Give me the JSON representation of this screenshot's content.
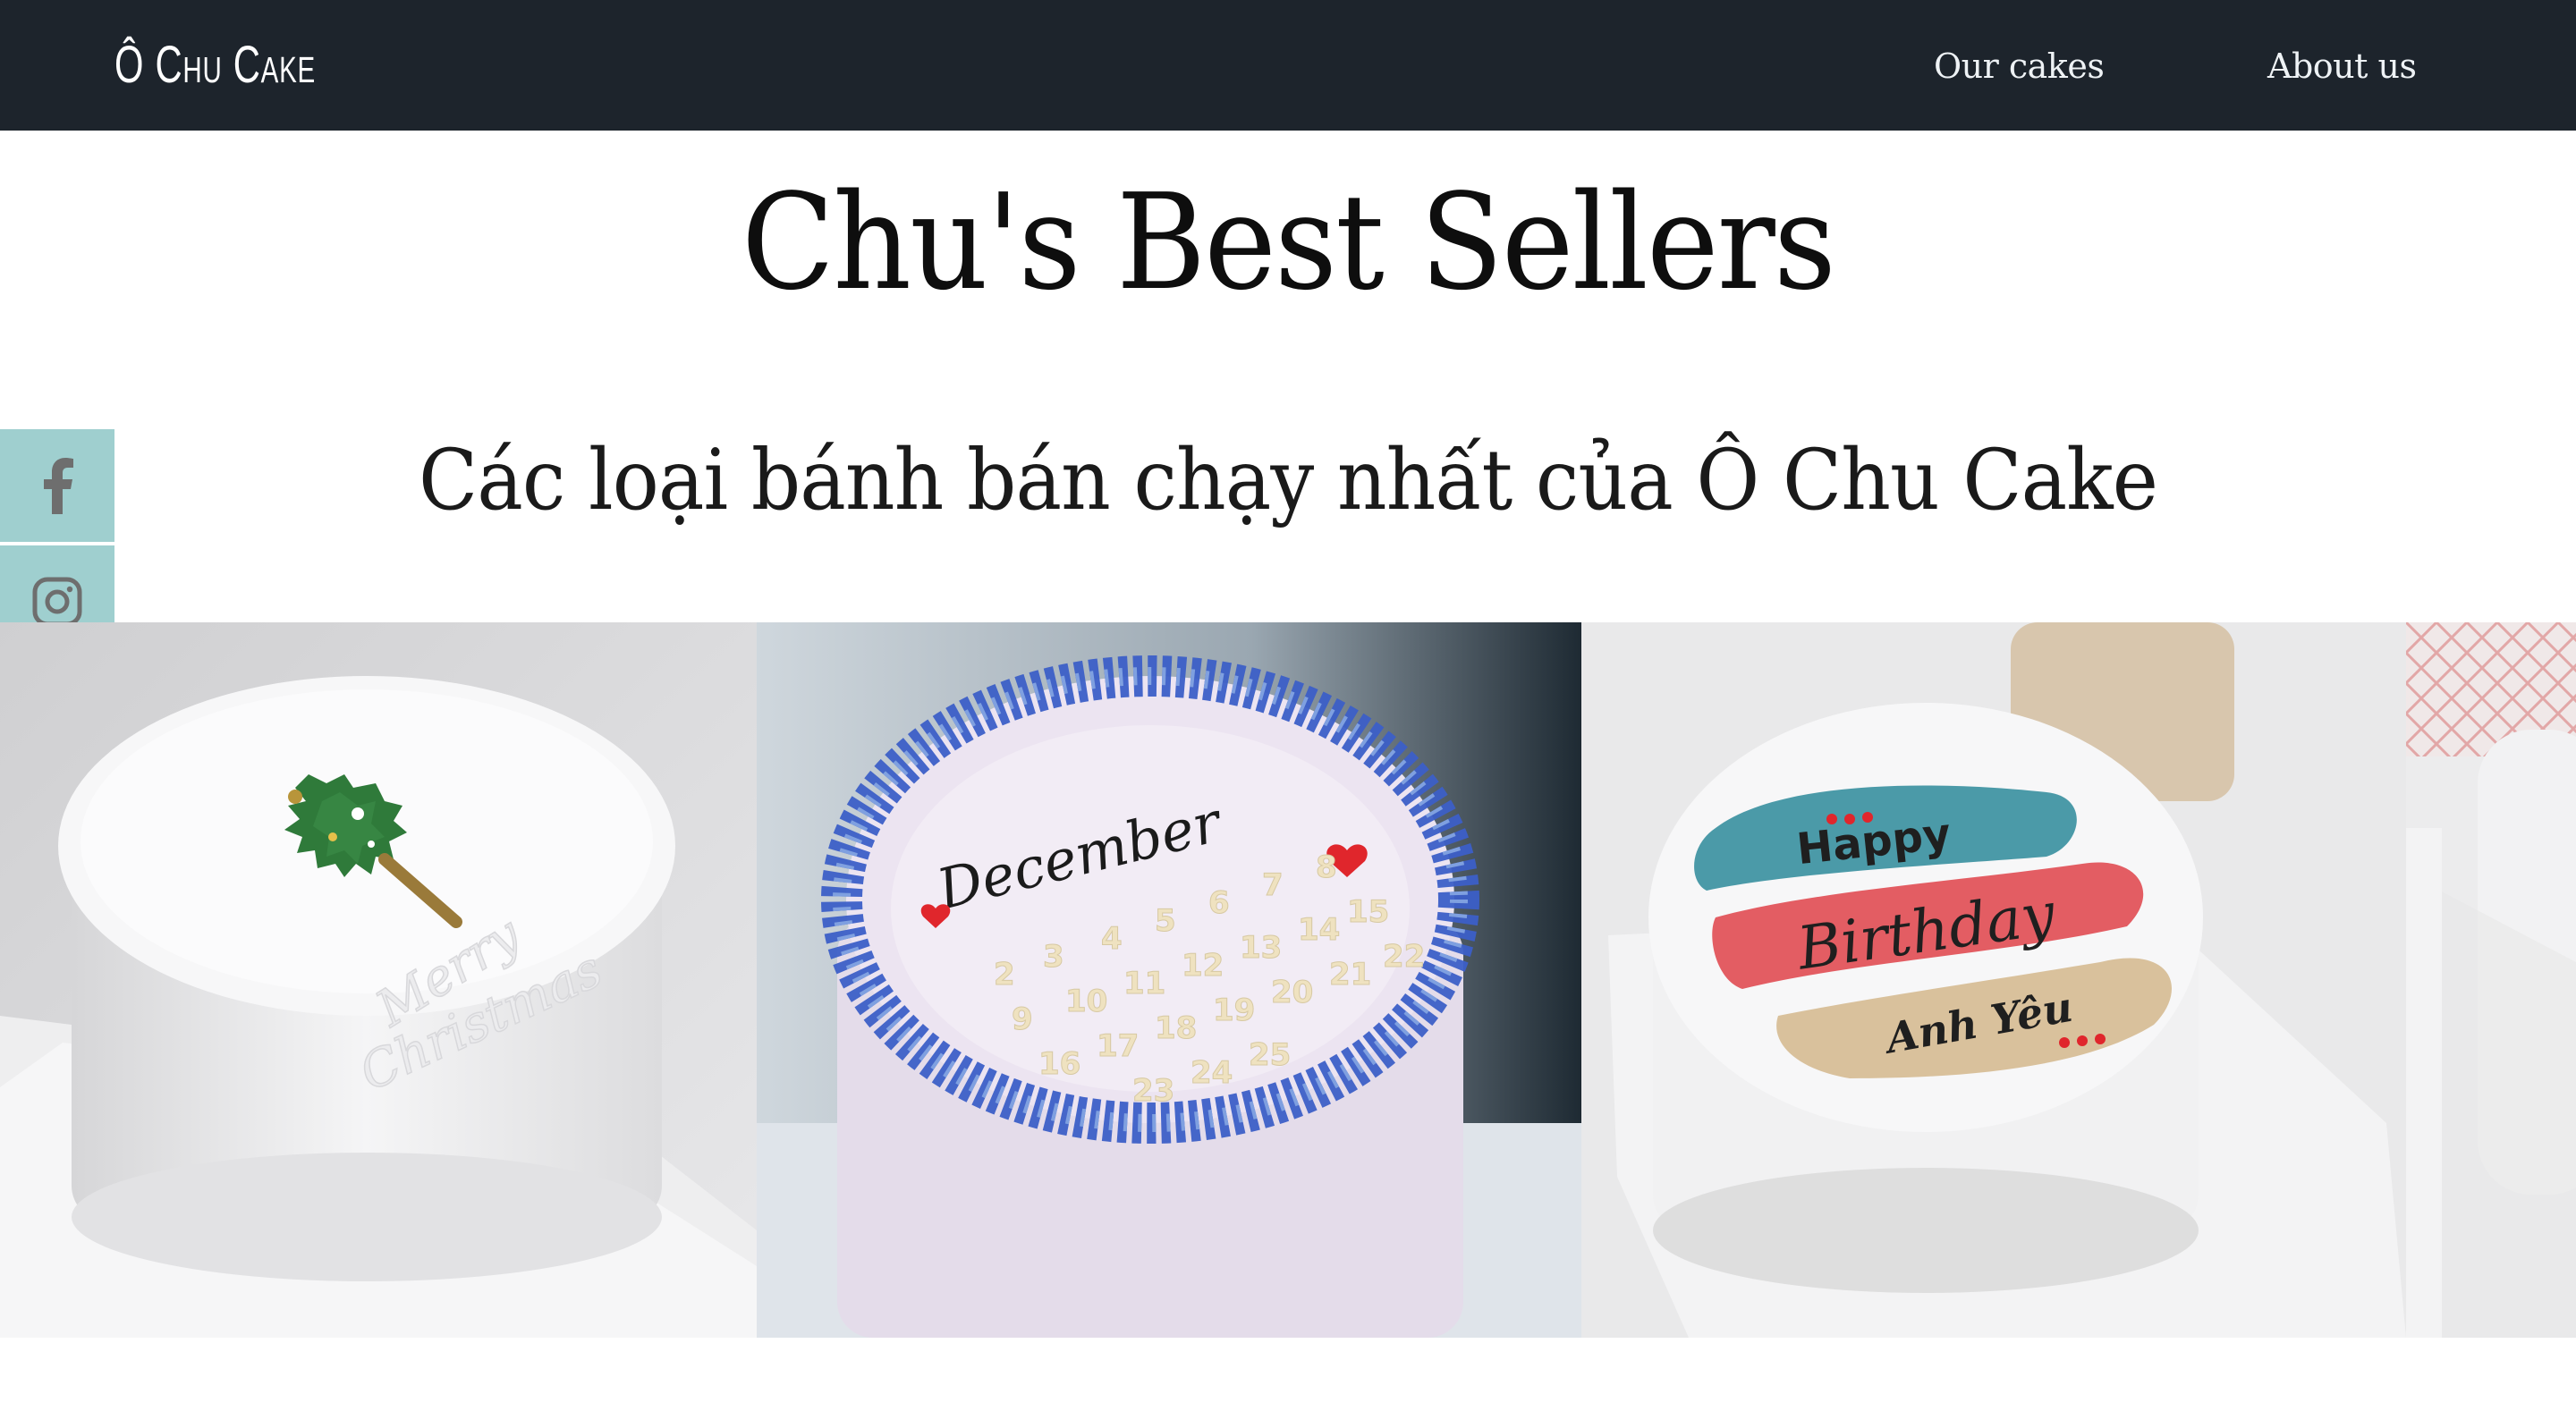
{
  "header": {
    "logo": "Ô Chu Cake",
    "nav": [
      {
        "label": "Our cakes"
      },
      {
        "label": "About us"
      }
    ]
  },
  "main": {
    "title": "Chu's Best Sellers",
    "subtitle": "Các loại bánh bán chạy nhất của Ô Chu Cake"
  },
  "social": [
    {
      "icon": "facebook-icon"
    },
    {
      "icon": "instagram-icon"
    }
  ],
  "gallery": {
    "cakes": [
      {
        "inscription": "Merry Christmas",
        "icon": "christmas-tree-decoration"
      },
      {
        "inscription": "December",
        "calendar_numbers": [
          "2",
          "3",
          "4",
          "5",
          "6",
          "7",
          "8",
          "9",
          "10",
          "11",
          "12",
          "13",
          "14",
          "15",
          "16",
          "17",
          "18",
          "19",
          "20",
          "21",
          "22",
          "23",
          "24",
          "25"
        ]
      },
      {
        "lines": [
          "Happy",
          "Birthday",
          "Anh Yêu"
        ]
      },
      {
        "inscription": ""
      }
    ]
  },
  "colors": {
    "header_bg": "#1d242c",
    "social_bg": "#9fcfcf",
    "blue_flowers": "#3c5fc7",
    "heart_red": "#e0262c"
  }
}
